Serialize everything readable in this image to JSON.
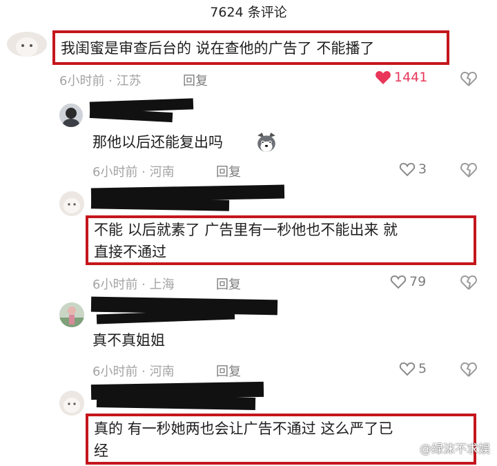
{
  "header": {
    "title": "7624 条评论"
  },
  "comments": [
    {
      "text_lines": [
        "我闺蜜是审查后台的 说在查他的广告了 不能播了"
      ],
      "time_location": "6小时前 · 江苏",
      "reply_label": "回复",
      "likes": "1441",
      "liked": true
    },
    {
      "text_lines": [
        "那他以后还能复出吗"
      ],
      "emoji": "husky-emoji",
      "time_location": "6小时前 · 河南",
      "reply_label": "回复",
      "likes": "3",
      "liked": false
    },
    {
      "text_lines": [
        "不能 以后就素了 广告里有一秒他也不能出来 就",
        "直接不通过"
      ],
      "time_location": "6小时前 · 上海",
      "reply_label": "回复",
      "likes": "79",
      "liked": false
    },
    {
      "text_lines": [
        "真不真姐姐"
      ],
      "time_location": "6小时前 · 河南",
      "reply_label": "回复",
      "likes": "5",
      "liked": false
    },
    {
      "text_lines": [
        "真的 有一秒她两也会让广告不通过 这么严了已",
        "经"
      ]
    }
  ],
  "watermark": "@绿沫不求娱",
  "colors": {
    "highlight_box": "#c4161c",
    "like_active": "#e8375a",
    "meta_gray": "#a3a3a3"
  }
}
